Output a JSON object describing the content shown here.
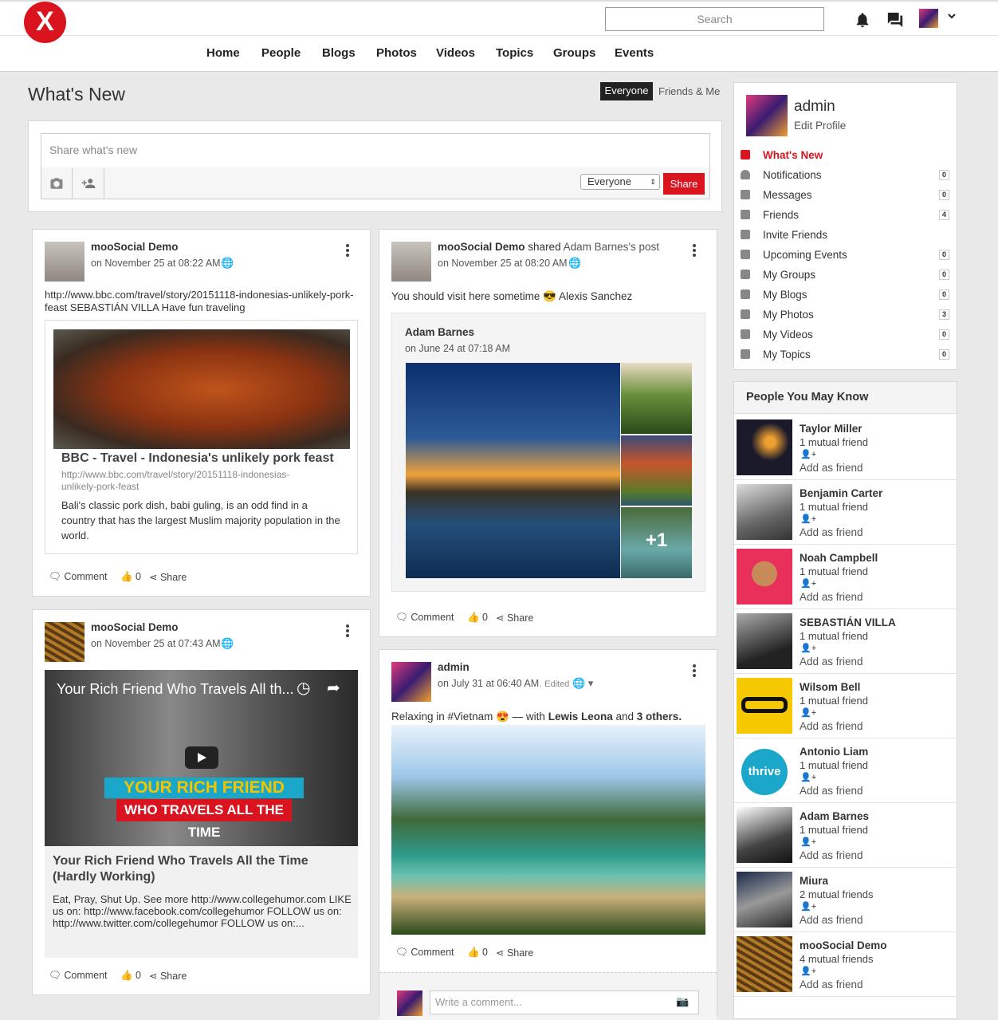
{
  "brand": {
    "accent": "#d9141f",
    "dark": "#222222"
  },
  "header": {
    "logo": "X",
    "search_placeholder": "Search"
  },
  "nav": [
    "Home",
    "People",
    "Blogs",
    "Photos",
    "Videos",
    "Topics",
    "Groups",
    "Events"
  ],
  "feed_header": {
    "title": "What's New",
    "tab_active": "Everyone",
    "tab_inactive": "Friends & Me"
  },
  "composer": {
    "placeholder": "Share what's new",
    "privacy": "Everyone",
    "share_label": "Share"
  },
  "actions": {
    "comment": "Comment",
    "likes": "0",
    "share": "Share"
  },
  "post1": {
    "author": "mooSocial Demo",
    "date": "on November 25 at 08:22 AM",
    "text": "http://www.bbc.com/travel/story/20151118-indonesias-unlikely-pork-feast SEBASTIÁN VILLA Have fun traveling",
    "link_title": "BBC - Travel - Indonesia's unlikely pork feast",
    "link_url": "http://www.bbc.com/travel/story/20151118-indonesias-unlikely-pork-feast",
    "link_desc": "Bali's classic pork dish, babi guling, is an odd find in a country that has the largest Muslim majority population in the world."
  },
  "post2": {
    "author": "mooSocial Demo",
    "date": "on November 25 at 07:43 AM",
    "video_overlay_title": "Your Rich Friend Who Travels All th...",
    "video_banner1": "YOUR RICH FRIEND",
    "video_banner2": "WHO TRAVELS ALL THE TIME",
    "video_title": "Your Rich Friend Who Travels All the Time (Hardly Working)",
    "video_desc": "Eat, Pray, Shut Up. See more http://www.collegehumor.com LIKE us on: http://www.facebook.com/collegehumor FOLLOW us on: http://www.twitter.com/collegehumor FOLLOW us on:..."
  },
  "post3": {
    "author": "mooSocial Demo",
    "shared": "shared",
    "orig_owner": "Adam Barnes's post",
    "date": "on November 25 at 08:20 AM",
    "text": "You should visit here sometime",
    "emoji": "😎",
    "tagged": "Alexis Sanchez",
    "inner_author": "Adam Barnes",
    "inner_date": "on June 24 at 07:18 AM",
    "more_photos": "+1"
  },
  "post4": {
    "author": "admin",
    "date": "on July 31 at 06:40 AM",
    "edited": ". Edited",
    "text": "Relaxing in #Vietnam",
    "emoji": "😍",
    "with_label": "— with",
    "with_name": "Lewis Leona",
    "and_label": "and",
    "others": "3 others.",
    "comment_placeholder": "Write a comment..."
  },
  "profile": {
    "name": "admin",
    "edit": "Edit Profile"
  },
  "sidebar_menu": [
    {
      "label": "What's New",
      "count": "",
      "icon": "feed-icon"
    },
    {
      "label": "Notifications",
      "count": "0",
      "icon": "bell-icon"
    },
    {
      "label": "Messages",
      "count": "0",
      "icon": "envelope-icon"
    },
    {
      "label": "Friends",
      "count": "4",
      "icon": "friends-icon"
    },
    {
      "label": "Invite Friends",
      "count": "",
      "icon": "share-icon"
    },
    {
      "label": "Upcoming Events",
      "count": "0",
      "icon": "calendar-icon"
    },
    {
      "label": "My Groups",
      "count": "0",
      "icon": "groups-icon"
    },
    {
      "label": "My Blogs",
      "count": "0",
      "icon": "blog-icon"
    },
    {
      "label": "My Photos",
      "count": "3",
      "icon": "photo-icon"
    },
    {
      "label": "My Videos",
      "count": "0",
      "icon": "video-icon"
    },
    {
      "label": "My Topics",
      "count": "0",
      "icon": "topic-icon"
    }
  ],
  "people_title": "People You May Know",
  "add_friend": "Add as friend",
  "thrive_label": "thrive",
  "people": [
    {
      "name": "Taylor Miller",
      "mutual": "1 mutual friend"
    },
    {
      "name": "Benjamin Carter",
      "mutual": "1 mutual friend"
    },
    {
      "name": "Noah Campbell",
      "mutual": "1 mutual friend"
    },
    {
      "name": "SEBASTIÁN VILLA",
      "mutual": "1 mutual friend"
    },
    {
      "name": "Wilsom Bell",
      "mutual": "1 mutual friend"
    },
    {
      "name": "Antonio Liam",
      "mutual": "1 mutual friend"
    },
    {
      "name": "Adam Barnes",
      "mutual": "1 mutual friend"
    },
    {
      "name": "Miura",
      "mutual": "2 mutual friends"
    },
    {
      "name": "mooSocial Demo",
      "mutual": "4 mutual friends"
    }
  ]
}
